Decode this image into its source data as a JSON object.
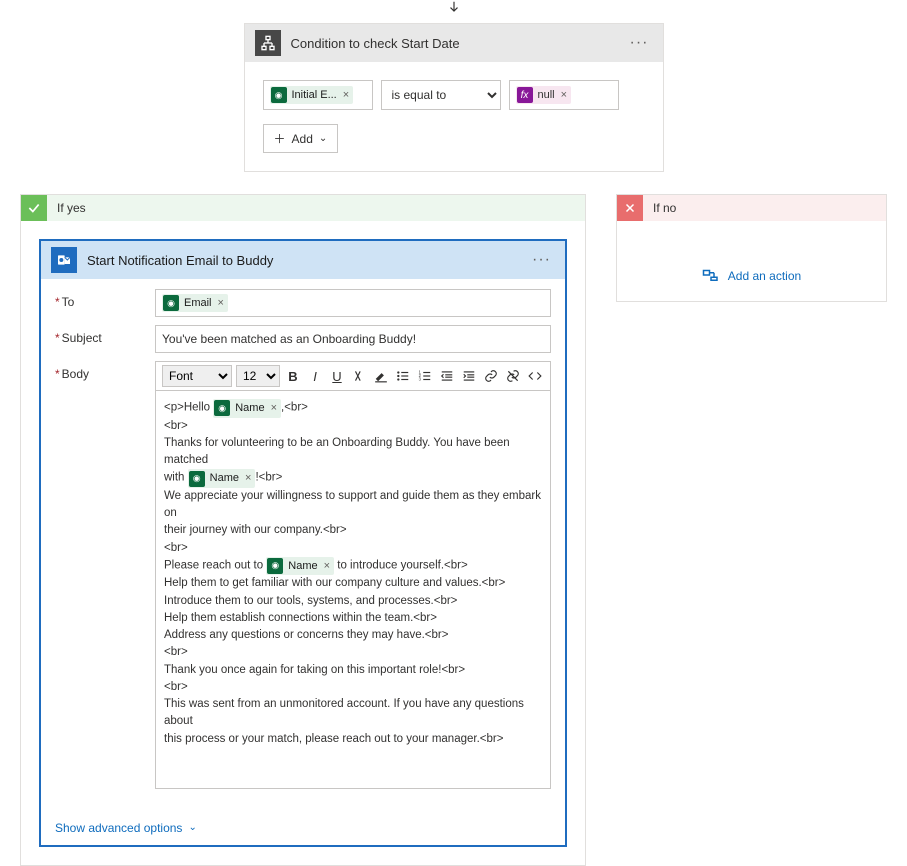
{
  "condition": {
    "title": "Condition to check Start Date",
    "left_token": "Initial E...",
    "operator": "is equal to",
    "right_token": "null",
    "add_label": "Add"
  },
  "branches": {
    "yes_label": "If yes",
    "no_label": "If no",
    "add_action_label": "Add an action"
  },
  "email_action": {
    "title": "Start Notification Email to Buddy",
    "labels": {
      "to": "To",
      "subject": "Subject",
      "body": "Body"
    },
    "to_token": "Email",
    "subject_value": "You've been matched as an Onboarding Buddy!",
    "toolbar": {
      "font_label": "Font",
      "size_label": "12"
    },
    "body": {
      "l1_pre": "<p>Hello ",
      "l1_tok": "Name",
      "l1_post": ",<br>",
      "l2": "<br>",
      "l3": "Thanks for volunteering to be an Onboarding Buddy. You have been matched",
      "l4_pre": "with ",
      "l4_tok": "Name",
      "l4_post": "!<br>",
      "l5": "We appreciate your willingness to support and guide them as they embark on",
      "l6": "their journey with our company.<br>",
      "l7": "<br>",
      "l8_pre": "Please reach out to ",
      "l8_tok": "Name",
      "l8_post": " to introduce yourself.<br>",
      "l9": "Help them to get familiar with our company culture and values.<br>",
      "l10": "Introduce them to our tools, systems, and processes.<br>",
      "l11": "Help them establish connections within the team.<br>",
      "l12": "Address any questions or concerns they may have.<br>",
      "l13": "<br>",
      "l14": "Thank you once again for taking on this important role!<br>",
      "l15": "<br>",
      "l16": "This was sent from an unmonitored account. If you have any questions about",
      "l17": "this process or your match, please reach out to your manager.<br>"
    },
    "advanced_label": "Show advanced options"
  }
}
